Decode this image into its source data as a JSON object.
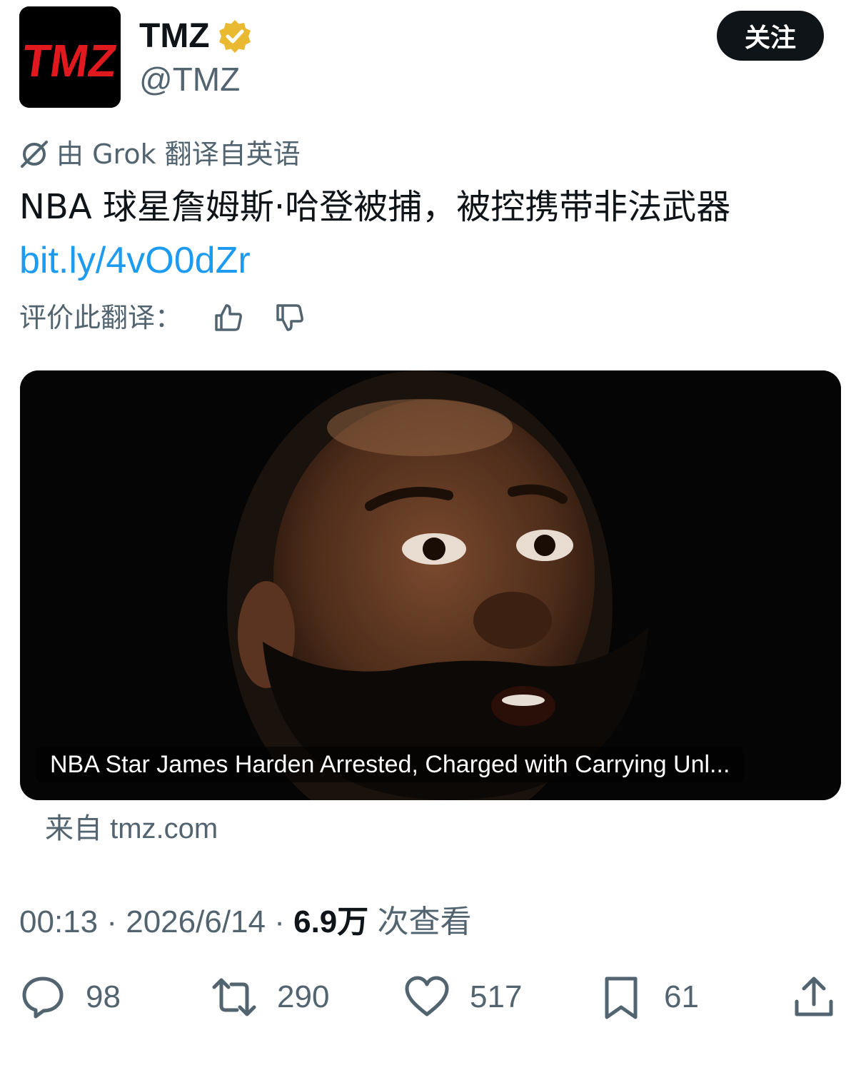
{
  "author": {
    "logo_text": "TMZ",
    "name": "TMZ",
    "handle": "@TMZ",
    "verified_icon": "verified-badge-icon",
    "verified_color": "#e8b931",
    "logo_color": "#e0191e"
  },
  "follow_button": {
    "label": "关注"
  },
  "translation": {
    "icon": "grok-icon",
    "note": "由 Grok 翻译自英语"
  },
  "tweet": {
    "text": "NBA 球星詹姆斯·哈登被捕，被控携带非法武器",
    "link": "bit.ly/4vO0dZr",
    "link_color": "#1d9bf0"
  },
  "rate_translation": {
    "label": "评价此翻译：",
    "thumbs_up_icon": "thumbs-up-icon",
    "thumbs_down_icon": "thumbs-down-icon"
  },
  "link_card": {
    "title": "NBA Star James Harden Arrested, Charged with Carrying Unl...",
    "source_label": "来自",
    "source_domain": "tmz.com"
  },
  "meta": {
    "time": "00:13",
    "date": "2026/6/14",
    "views": "6.9万",
    "views_label": "次查看"
  },
  "actions": {
    "replies": "98",
    "reposts": "290",
    "likes": "517",
    "bookmarks": "61"
  }
}
